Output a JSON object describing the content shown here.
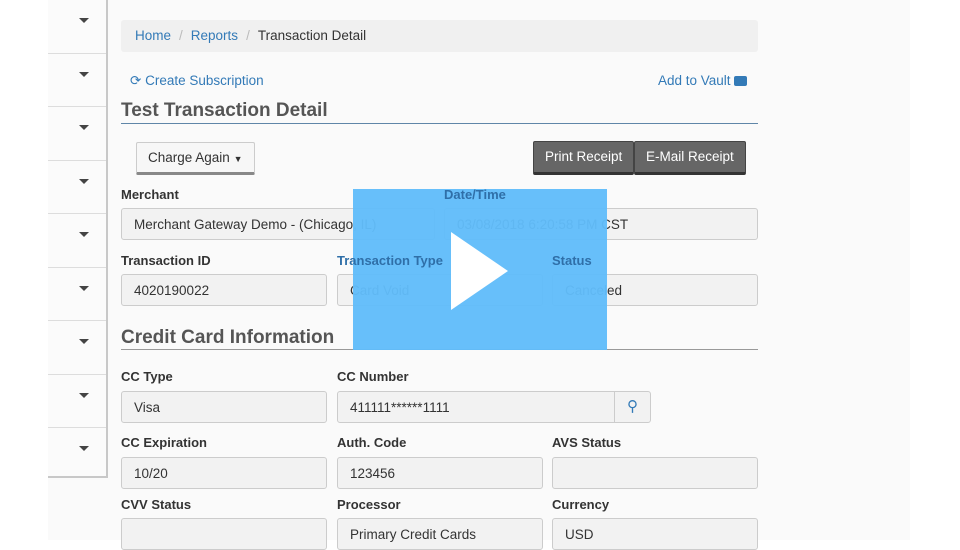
{
  "breadcrumb": {
    "home": "Home",
    "reports": "Reports",
    "current": "Transaction Detail",
    "sep": "/"
  },
  "actions": {
    "create_subscription": "Create Subscription",
    "add_to_vault": "Add to Vault"
  },
  "title": "Test Transaction Detail",
  "buttons": {
    "charge_again": "Charge Again",
    "print_receipt": "Print Receipt",
    "email_receipt": "E-Mail Receipt"
  },
  "transaction": {
    "merchant_label": "Merchant",
    "merchant": "Merchant Gateway Demo - (Chicago, IL)",
    "datetime_label": "Date/Time",
    "datetime": "03/08/2018 6:20:58 PM CST",
    "id_label": "Transaction ID",
    "id": "4020190022",
    "type_label": "Transaction Type",
    "type": "Card Void",
    "status_label": "Status",
    "status": "Canceled"
  },
  "cc_section": "Credit Card Information",
  "cc": {
    "type_label": "CC Type",
    "type": "Visa",
    "number_label": "CC Number",
    "number": "411111******1111",
    "exp_label": "CC Expiration",
    "exp": "10/20",
    "auth_label": "Auth. Code",
    "auth": "123456",
    "avs_label": "AVS Status",
    "avs": "",
    "cvv_label": "CVV Status",
    "cvv": "",
    "processor_label": "Processor",
    "processor": "Primary Credit Cards",
    "currency_label": "Currency",
    "currency": "USD"
  },
  "video": {
    "accent": "#61bcfa",
    "icon": "play-icon"
  }
}
